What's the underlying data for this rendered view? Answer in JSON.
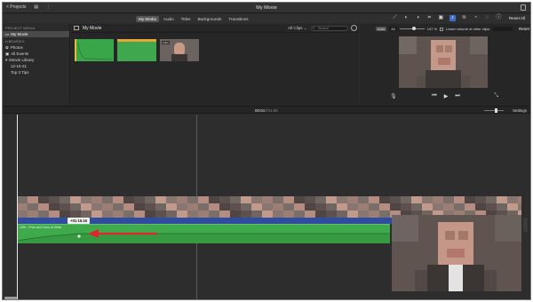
{
  "titlebar": {
    "projects_label": "< Projects",
    "window_title": "My Movie"
  },
  "tabs": [
    "My Media",
    "Audio",
    "Titles",
    "Backgrounds",
    "Transitions"
  ],
  "active_tab": "My Media",
  "toolbar": {
    "reset_all_label": "Reset All"
  },
  "library": {
    "project_media_header": "PROJECT MEDIA",
    "project_item": "My Movie",
    "libraries_header": "LIBRARIES",
    "items": [
      "Photos",
      "All Events"
    ],
    "library_name": "iMovie Library",
    "events": [
      "12-16-21",
      "Top 3 Tips"
    ]
  },
  "browser": {
    "title": "My Movie",
    "filter_label": "All Clips",
    "search_placeholder": "Search",
    "clips": [
      {
        "name": "clip-green-1"
      },
      {
        "name": "clip-green-2"
      },
      {
        "name": "clip-face",
        "duration": "1.0m"
      }
    ]
  },
  "viewer": {
    "auto_label": "Auto",
    "all_label": "All",
    "volume_value": "147 %",
    "lower_volume_label": "Lower volume of other clips:",
    "reset_label": "Reset"
  },
  "timeline": {
    "current_time": "00:04",
    "total_duration": "01:05",
    "settings_label": "Settings",
    "audio_clip_label": "13th - Pros and Cons of Irritat",
    "tooltip": "+01:15.16"
  },
  "colors": {
    "accent_blue": "#3d6fc6",
    "audio_green": "#3faa4c",
    "title_blue": "#2f4c9e",
    "arrow_red": "#e0242a"
  }
}
